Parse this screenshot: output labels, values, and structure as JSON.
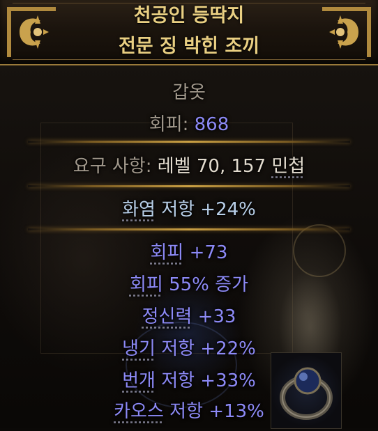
{
  "header": {
    "title_line1": "천공인 등딱지",
    "title_line2": "전문 징 박힌 조끼"
  },
  "item": {
    "item_class": "갑옷",
    "evasion_label": "회피: ",
    "evasion_value": "868",
    "requirements_label": "요구 사항: ",
    "requirements_prefix": "레벨 70, 157 ",
    "requirements_attr": "민첩"
  },
  "implicit": {
    "fire_resist_label": "화염",
    "fire_resist_rest": " 저항 +24%"
  },
  "explicit": [
    {
      "label": "회피",
      "rest": " +73"
    },
    {
      "label": "회피",
      "rest": " 55% 증가"
    },
    {
      "label": "정신력",
      "rest": " +33"
    },
    {
      "label": "냉기",
      "rest": " 저항 +22%"
    },
    {
      "label": "번개",
      "rest": " 저항 +33%"
    },
    {
      "label": "카오스",
      "rest": " 저항 +13%"
    }
  ],
  "colors": {
    "title": "#e9cf82",
    "magic_mod": "#8d8af7",
    "implicit_mod": "#b8cfe8",
    "separator": "#caa044"
  },
  "icons": [
    "left-fleur-ornament-icon",
    "right-fleur-ornament-icon",
    "ring-item-icon"
  ]
}
